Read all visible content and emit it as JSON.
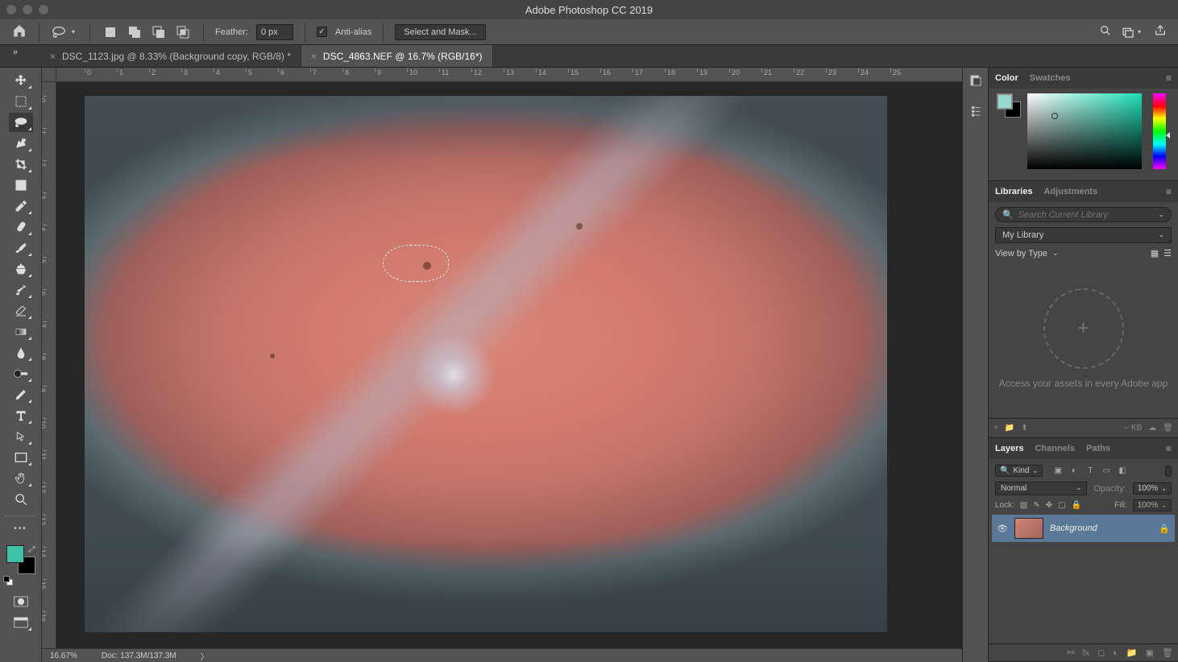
{
  "app": {
    "title": "Adobe Photoshop CC 2019"
  },
  "options": {
    "feather_label": "Feather:",
    "feather_value": "0 px",
    "antialias_label": "Anti-alias",
    "select_mask": "Select and Mask..."
  },
  "tabs": [
    {
      "label": "DSC_1123.jpg @ 8.33% (Background copy, RGB/8) *",
      "active": false
    },
    {
      "label": "DSC_4863.NEF @ 16.7% (RGB/16*)",
      "active": true
    }
  ],
  "ruler_h": [
    0,
    1,
    2,
    3,
    4,
    5,
    6,
    7,
    8,
    9,
    10,
    11,
    12,
    13,
    14,
    15,
    16,
    17,
    18,
    19,
    20,
    21,
    22,
    23,
    24,
    25
  ],
  "ruler_v": [
    0,
    1,
    2,
    3,
    4,
    5,
    6,
    7,
    8,
    9,
    10,
    11,
    12,
    13,
    14,
    15,
    16
  ],
  "status": {
    "zoom": "16.67%",
    "doc": "Doc: 137.3M/137.3M"
  },
  "panels": {
    "color": {
      "tab1": "Color",
      "tab2": "Swatches"
    },
    "libraries": {
      "tab1": "Libraries",
      "tab2": "Adjustments",
      "search_placeholder": "Search Current Library",
      "dropdown": "My Library",
      "viewby": "View by Type",
      "caption": "Access your assets in every Adobe app",
      "kb": "-- KB"
    },
    "layers": {
      "tab1": "Layers",
      "tab2": "Channels",
      "tab3": "Paths",
      "kind": "Kind",
      "blend": "Normal",
      "opacity_label": "Opacity:",
      "opacity": "100%",
      "lock_label": "Lock:",
      "fill_label": "Fill:",
      "fill": "100%",
      "layer_name": "Background"
    }
  }
}
